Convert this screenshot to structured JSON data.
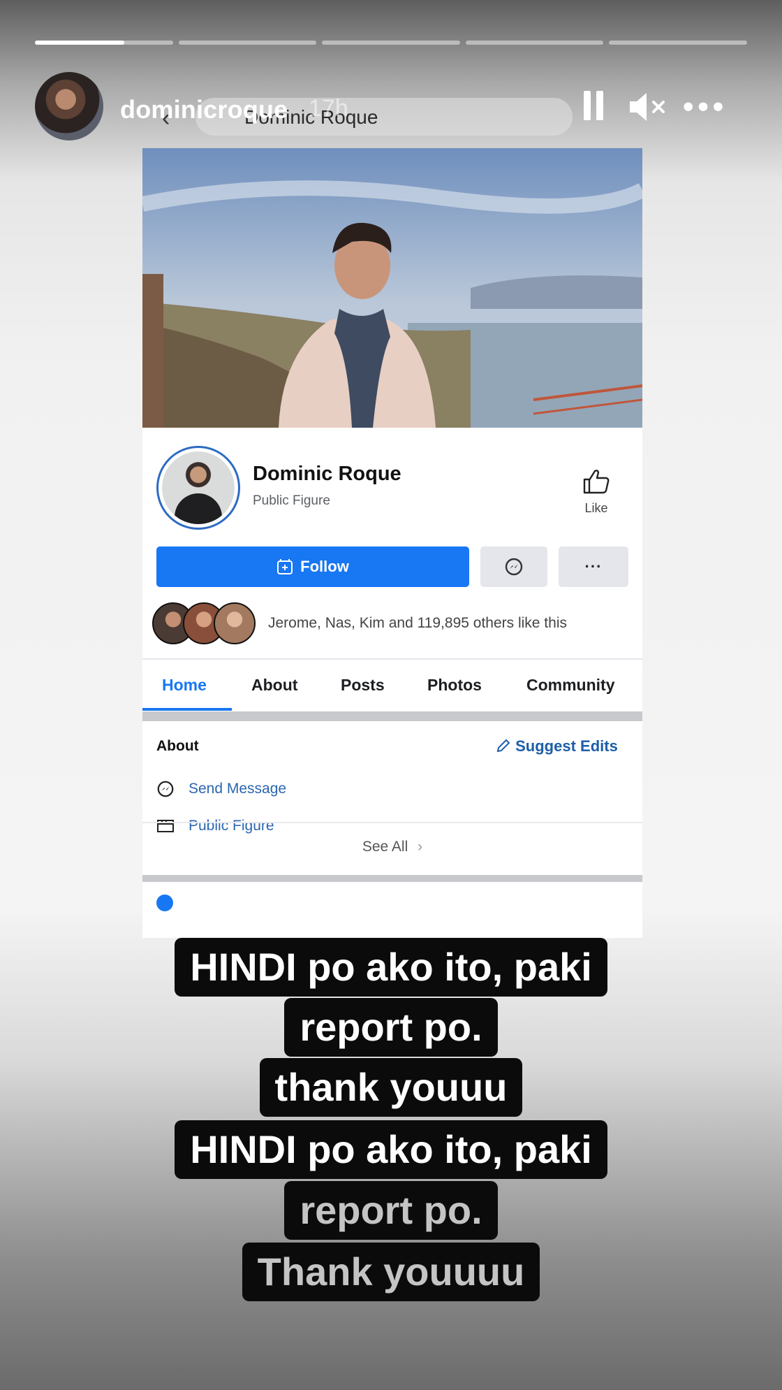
{
  "story": {
    "username": "dominicroque",
    "time_ago": "17h",
    "segments": [
      {
        "progress": 0.65
      },
      {
        "progress": 0
      },
      {
        "progress": 0
      },
      {
        "progress": 0
      },
      {
        "progress": 0
      }
    ],
    "pause_icon": "pause-icon",
    "mute_icon": "mute-icon",
    "more_icon": "more-icon",
    "more_label": "•••"
  },
  "browser": {
    "back_glyph": "‹",
    "search_query": "Dominic Roque"
  },
  "fb_page": {
    "name": "Dominic Roque",
    "category": "Public Figure",
    "like_label": "Like",
    "follow_label": "Follow",
    "more_label": "···",
    "likes_text": "Jerome, Nas, Kim and 119,895 others like this",
    "tabs": [
      {
        "label": "Home"
      },
      {
        "label": "About"
      },
      {
        "label": "Posts"
      },
      {
        "label": "Photos"
      },
      {
        "label": "Community"
      }
    ],
    "about": {
      "title": "About",
      "suggest_edits": "Suggest Edits",
      "send_message": "Send Message",
      "public_figure": "Public Figure",
      "see_all": "See All"
    },
    "colors": {
      "accent": "#1877f2",
      "link": "#2b66b0"
    }
  },
  "caption": {
    "lines": [
      "HINDI po ako ito, paki",
      "report po.",
      "thank youuu",
      "HINDI po ako ito, paki",
      "report po.",
      "Thank youuuu"
    ]
  }
}
